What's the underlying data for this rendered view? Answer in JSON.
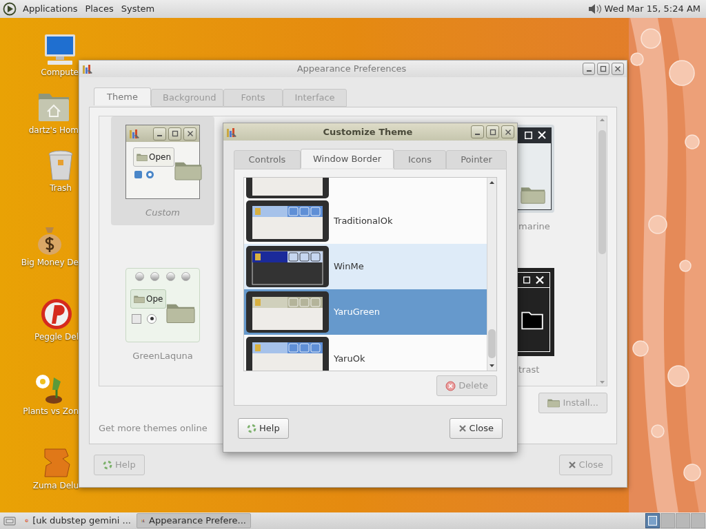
{
  "top_panel": {
    "menus": [
      "Applications",
      "Places",
      "System"
    ],
    "clock": "Wed Mar 15, 5:24 AM"
  },
  "desktop_icons": [
    {
      "label": "Compute",
      "kind": "computer"
    },
    {
      "label": "dartz's Hom",
      "kind": "home"
    },
    {
      "label": "Trash",
      "kind": "trash"
    },
    {
      "label": "Big Money De",
      "kind": "money"
    },
    {
      "label": "Peggle Del",
      "kind": "peggle"
    },
    {
      "label": "Plants vs Zon",
      "kind": "plants"
    },
    {
      "label": "Zuma Delu",
      "kind": "zuma"
    }
  ],
  "appearance_window": {
    "title": "Appearance Preferences",
    "tabs": [
      {
        "label": "Theme",
        "selected": true
      },
      {
        "label": "Background",
        "selected": false
      },
      {
        "label": "Fonts",
        "selected": false
      },
      {
        "label": "Interface",
        "selected": false
      }
    ],
    "theme_rows": [
      [
        {
          "label": "Custom",
          "kind": "custom",
          "button_text": "Open",
          "selected": true
        },
        {
          "label": "marine",
          "kind": "dark-title",
          "selected": false
        }
      ],
      [
        {
          "label": "GreenLaquna",
          "kind": "laquna",
          "button_text": "Ope",
          "selected": false
        },
        {
          "label": "trast",
          "kind": "contrast",
          "selected": false
        }
      ]
    ],
    "install_button": {
      "label": "Install...",
      "disabled": true
    },
    "online_link": "Get more themes online",
    "help_button": {
      "label": "Help",
      "disabled": true
    },
    "close_button": {
      "label": "Close",
      "disabled": true
    }
  },
  "dialog": {
    "title": "Customize Theme",
    "tabs": [
      {
        "label": "Controls",
        "selected": false
      },
      {
        "label": "Window Border",
        "selected": true
      },
      {
        "label": "Icons",
        "selected": false
      },
      {
        "label": "Pointer",
        "selected": false
      }
    ],
    "rows": [
      {
        "kind": "plain",
        "selected": false,
        "hovered": false
      },
      {
        "label": "TraditionalOk",
        "kind": "blue",
        "selected": false,
        "hovered": false
      },
      {
        "label": "WinMe",
        "kind": "classic",
        "selected": false,
        "hovered": true
      },
      {
        "label": "YaruGreen",
        "kind": "olive",
        "selected": true,
        "hovered": false
      },
      {
        "label": "YaruOk",
        "kind": "blue",
        "selected": false,
        "hovered": false
      }
    ],
    "delete_button": {
      "label": "Delete",
      "disabled": true
    },
    "help_button": {
      "label": "Help",
      "disabled": false
    },
    "close_button": {
      "label": "Close",
      "disabled": false
    }
  },
  "taskbar": {
    "tasks": [
      {
        "label": "[uk dubstep gemini ...",
        "kind": "browser",
        "selected": false
      },
      {
        "label": "Appearance Prefere...",
        "kind": "appearance",
        "selected": true
      }
    ],
    "workspaces": [
      {
        "selected": true
      },
      {
        "selected": false
      },
      {
        "selected": false
      },
      {
        "selected": false
      }
    ]
  }
}
